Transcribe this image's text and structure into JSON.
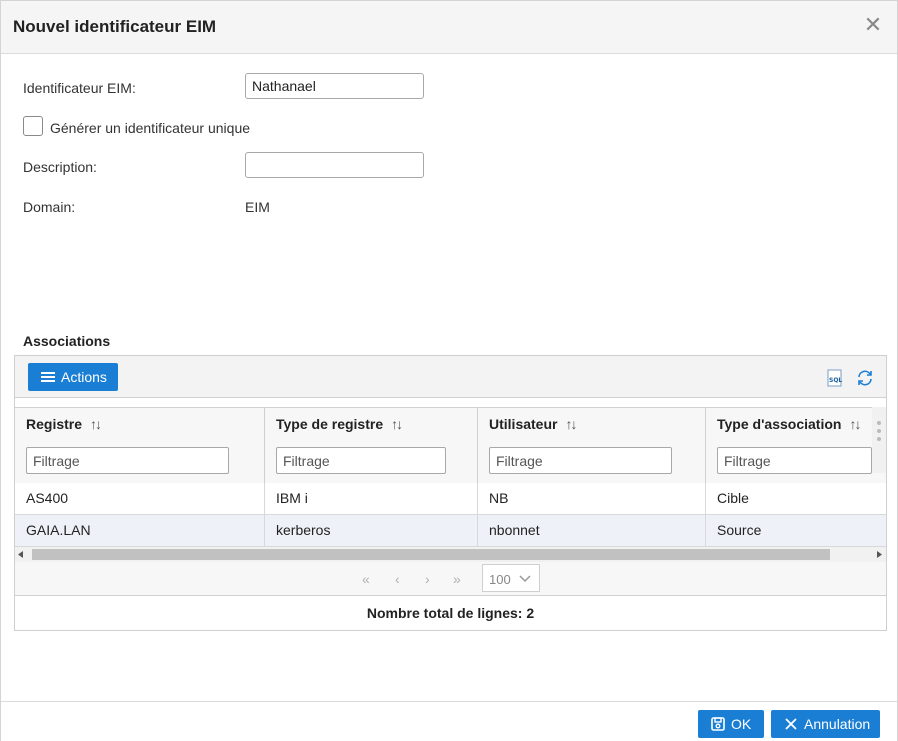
{
  "dialog": {
    "title": "Nouvel identificateur EIM"
  },
  "form": {
    "identifier_label": "Identificateur EIM:",
    "identifier_value": "Nathanael",
    "unique_label": "Générer un identificateur unique",
    "unique_checked": false,
    "description_label": "Description:",
    "description_value": "",
    "domain_label": "Domain:",
    "domain_value": "EIM"
  },
  "associations": {
    "title": "Associations",
    "actions_label": "Actions",
    "filter_placeholder": "Filtrage",
    "columns": [
      {
        "label": "Registre"
      },
      {
        "label": "Type de registre"
      },
      {
        "label": "Utilisateur"
      },
      {
        "label": "Type d'association"
      }
    ],
    "rows": [
      [
        "AS400",
        "IBM i",
        "NB",
        "Cible"
      ],
      [
        "GAIA.LAN",
        "kerberos",
        "nbonnet",
        "Source"
      ]
    ],
    "page_size": "100",
    "total_label": "Nombre total de lignes: 2"
  },
  "footer": {
    "ok_label": "OK",
    "cancel_label": "Annulation"
  },
  "colors": {
    "accent": "#1a7fd4",
    "header_bg": "#f5f5f5"
  },
  "icons": {
    "close": "close-icon",
    "menu": "hamburger-icon",
    "sql": "sql-icon",
    "refresh": "refresh-icon",
    "sort": "sort-icon",
    "save": "save-icon",
    "cancel": "x-icon"
  }
}
